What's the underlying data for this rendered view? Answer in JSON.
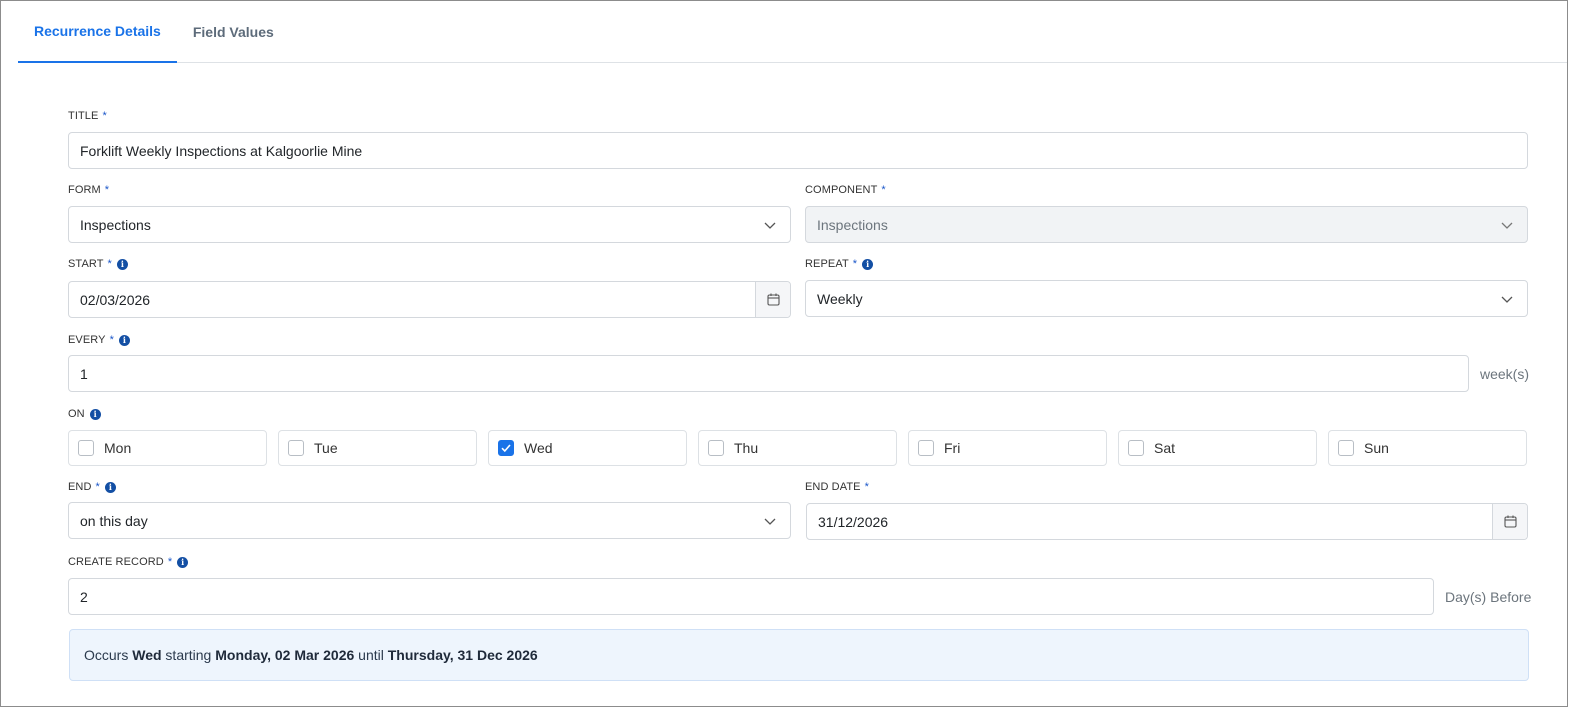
{
  "tabs": [
    {
      "label": "Recurrence Details",
      "active": true
    },
    {
      "label": "Field Values",
      "active": false
    }
  ],
  "form": {
    "required_mark": "*",
    "info_glyph": "i",
    "title": {
      "label": "TITLE",
      "value": "Forklift Weekly Inspections at Kalgoorlie Mine"
    },
    "form": {
      "label": "FORM",
      "value": "Inspections"
    },
    "component": {
      "label": "COMPONENT",
      "value": "Inspections",
      "disabled": true
    },
    "start": {
      "label": "START",
      "value": "02/03/2026"
    },
    "repeat": {
      "label": "REPEAT",
      "value": "Weekly"
    },
    "every": {
      "label": "EVERY",
      "value": "1",
      "suffix": "week(s)"
    },
    "on": {
      "label": "ON",
      "days": [
        {
          "label": "Mon",
          "checked": false
        },
        {
          "label": "Tue",
          "checked": false
        },
        {
          "label": "Wed",
          "checked": true
        },
        {
          "label": "Thu",
          "checked": false
        },
        {
          "label": "Fri",
          "checked": false
        },
        {
          "label": "Sat",
          "checked": false
        },
        {
          "label": "Sun",
          "checked": false
        }
      ]
    },
    "end": {
      "label": "END",
      "value": "on this day"
    },
    "end_date": {
      "label": "END DATE",
      "value": "31/12/2026"
    },
    "create_record": {
      "label": "CREATE RECORD",
      "value": "2",
      "suffix": "Day(s) Before"
    }
  },
  "summary": {
    "prefix": "Occurs ",
    "day": "Wed",
    "starting_text": " starting ",
    "start_date": "Monday, 02 Mar 2026",
    "until_text": " until ",
    "end_date": "Thursday, 31 Dec 2026"
  },
  "colors": {
    "accent": "#1a73e8",
    "info_icon": "#134fa4",
    "summary_bg": "#eef5fd"
  },
  "icons": {
    "dropdown": "chevron-down-icon",
    "date": "calendar-icon",
    "info": "info-icon",
    "check": "check-icon"
  }
}
